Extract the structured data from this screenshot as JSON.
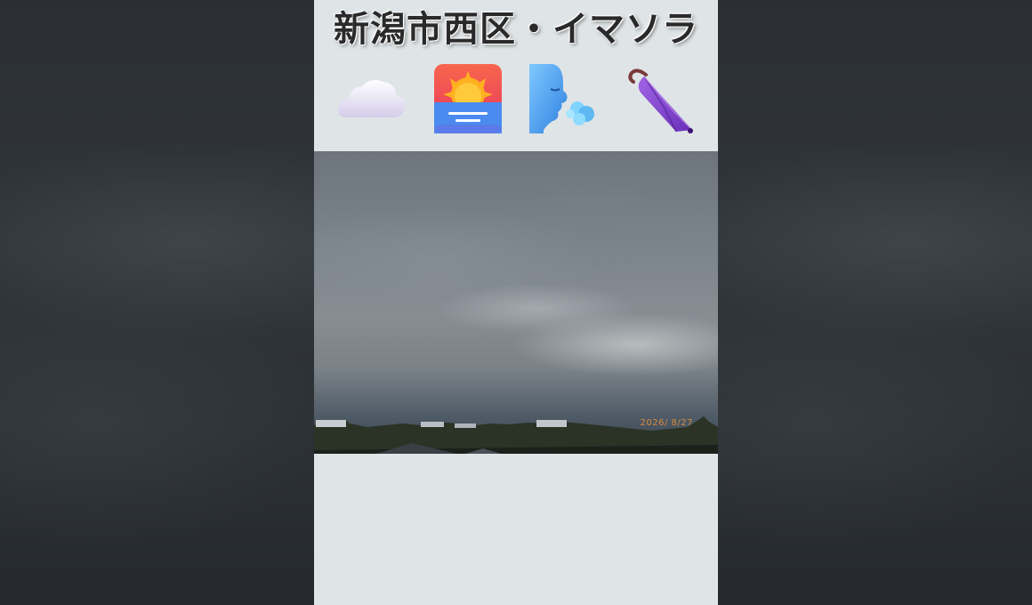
{
  "title": "新潟市西区・イマソラ",
  "icons": [
    "cloud-icon",
    "sunrise-icon",
    "wind-face-icon",
    "closed-umbrella-icon"
  ],
  "photo": {
    "date_stamp": "2026/ 8/27"
  },
  "colors": {
    "panel_background": "#dfe4e7",
    "side_background": "#2b2f33",
    "date_stamp": "#d98a3c"
  }
}
